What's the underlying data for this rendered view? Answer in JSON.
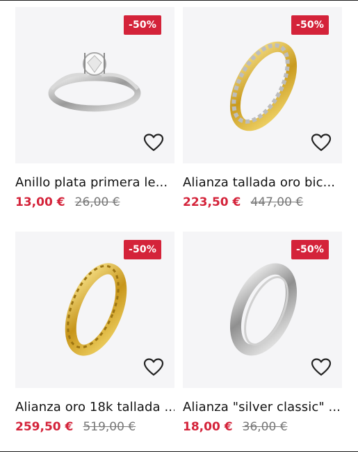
{
  "products": [
    {
      "title": "Anillo plata primera le...",
      "price": "13,00 €",
      "old_price": "26,00 €",
      "discount": "-50%",
      "ring": "silver-solitaire"
    },
    {
      "title": "Alianza tallada oro bic...",
      "price": "223,50 €",
      "old_price": "447,00 €",
      "discount": "-50%",
      "ring": "gold-diamond-cut"
    },
    {
      "title": "Alianza oro 18k tallada ...",
      "price": "259,50 €",
      "old_price": "519,00 €",
      "discount": "-50%",
      "ring": "gold-greek-key"
    },
    {
      "title": "Alianza \"silver classic\" ...",
      "price": "18,00 €",
      "old_price": "36,00 €",
      "discount": "-50%",
      "ring": "silver-plain"
    }
  ],
  "icons": {
    "wishlist": "heart-outline-icon"
  },
  "colors": {
    "discount": "#d4233a",
    "card_bg": "#f5f5f7"
  }
}
